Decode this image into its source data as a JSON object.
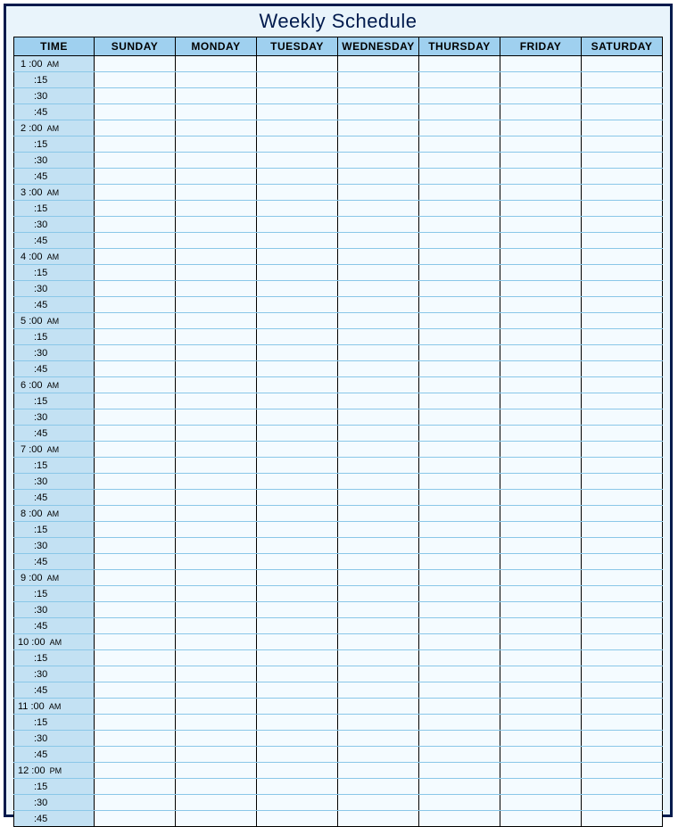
{
  "title": "Weekly Schedule",
  "columns": [
    "TIME",
    "SUNDAY",
    "MONDAY",
    "TUESDAY",
    "WEDNESDAY",
    "THURSDAY",
    "FRIDAY",
    "SATURDAY"
  ],
  "hours": [
    {
      "hour": "1",
      "suffix": "AM"
    },
    {
      "hour": "2",
      "suffix": "AM"
    },
    {
      "hour": "3",
      "suffix": "AM"
    },
    {
      "hour": "4",
      "suffix": "AM"
    },
    {
      "hour": "5",
      "suffix": "AM"
    },
    {
      "hour": "6",
      "suffix": "AM"
    },
    {
      "hour": "7",
      "suffix": "AM"
    },
    {
      "hour": "8",
      "suffix": "AM"
    },
    {
      "hour": "9",
      "suffix": "AM"
    },
    {
      "hour": "10",
      "suffix": "AM"
    },
    {
      "hour": "11",
      "suffix": "AM"
    },
    {
      "hour": "12",
      "suffix": "PM"
    }
  ],
  "subdivisions": [
    ":15",
    ":30",
    ":45"
  ]
}
